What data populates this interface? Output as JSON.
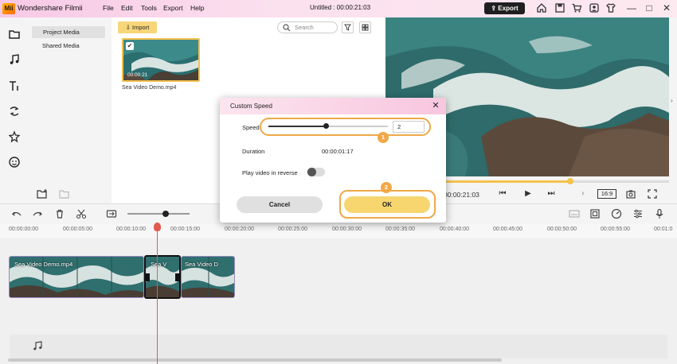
{
  "app": {
    "name": "Wondershare Filmii",
    "logo_text": "Mii",
    "menu": [
      "File",
      "Edit",
      "Tools",
      "Export",
      "Help"
    ],
    "document_title": "Untitled :  00:00:21:03",
    "export_label": "Export",
    "window_controls": [
      "—",
      "□",
      "✕"
    ]
  },
  "rail_icons": [
    "folder-icon",
    "music-icon",
    "text-icon",
    "transition-icon",
    "effects-icon",
    "sticker-icon"
  ],
  "media_panel": {
    "nav": {
      "project_media": "Project Media",
      "shared_media": "Shared Media"
    },
    "import_label": "Import",
    "search_placeholder": "Search",
    "thumbnail": {
      "filename": "Sea Video Demo.mp4",
      "duration": "00:00:21"
    }
  },
  "preview": {
    "time": "00:00:21:03",
    "ratio": "16:9",
    "progress": 0.57
  },
  "timeline": {
    "ruler_labels": [
      "00:00:00:00",
      "00:00:05:00",
      "00:00:10:00",
      "00:00:15:00",
      "00:00:20:00",
      "00:00:25:00",
      "00:00:30:00",
      "00:00:35:00",
      "00:00:40:00",
      "00:00:45:00",
      "00:00:50:00",
      "00:00:55:00",
      "00:01:0"
    ],
    "clips": {
      "clip1": "Sea Video Demo.mp4",
      "clip2": "Sea V",
      "clip3": "Sea Video D"
    }
  },
  "dialog": {
    "title": "Custom Speed",
    "close": "✕",
    "speed_label": "Speed",
    "speed_value": "2",
    "duration_label": "Duration",
    "duration_value": "00:00:01:17",
    "reverse_label": "Play video in reverse",
    "reverse_on": false,
    "cancel_label": "Cancel",
    "ok_label": "OK",
    "badges": [
      "1",
      "2"
    ]
  },
  "colors": {
    "accent": "#f5c24c",
    "highlight": "#f0a848",
    "playhead": "#e25a4e",
    "clip_border": "#9b89c5"
  }
}
